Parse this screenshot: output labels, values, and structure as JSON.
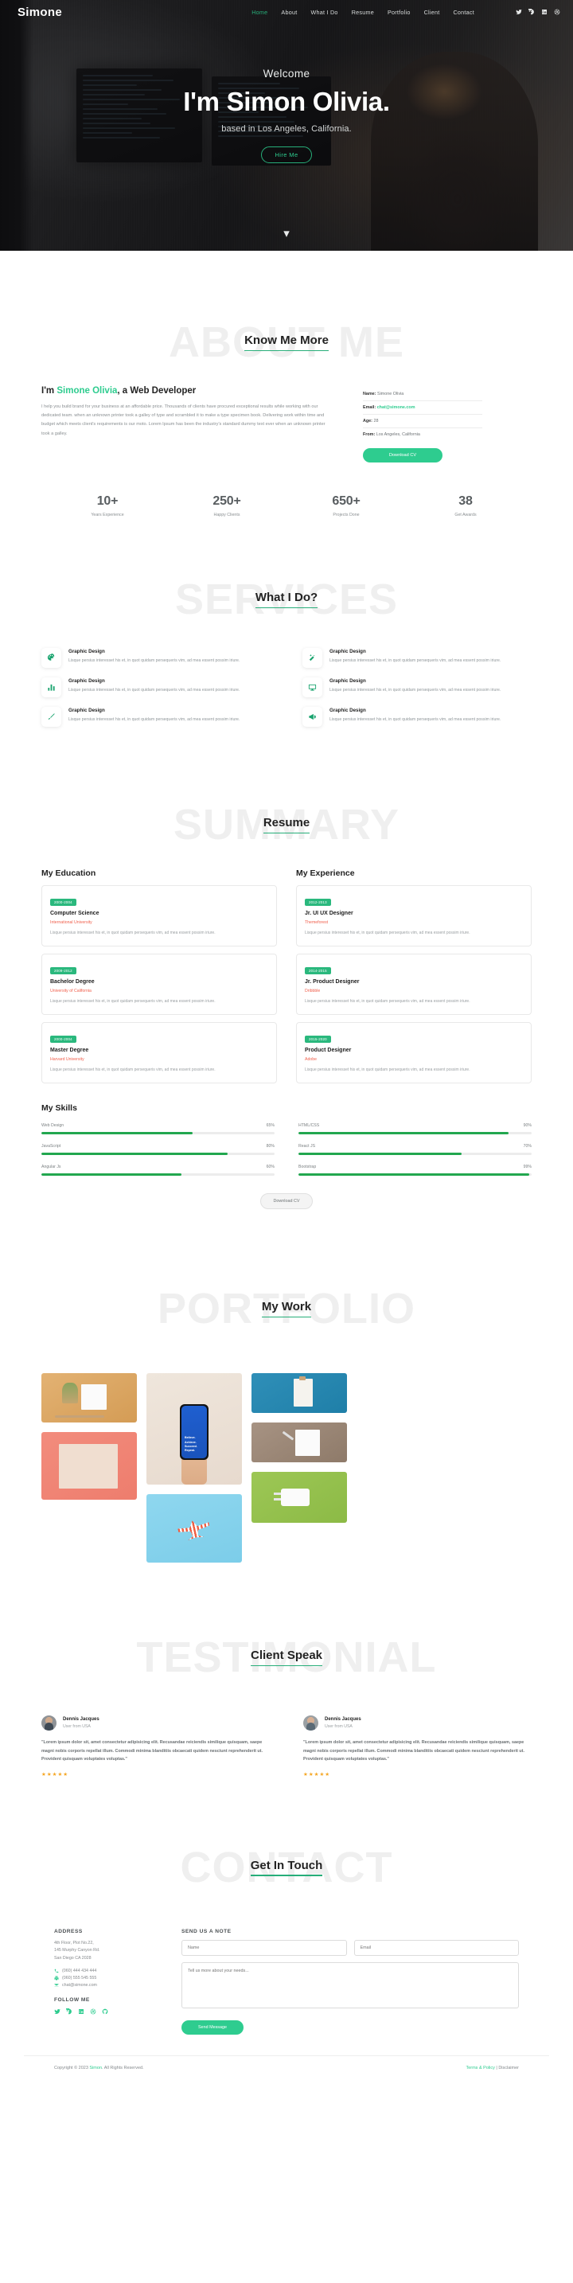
{
  "brand": "Simone",
  "nav": {
    "items": [
      {
        "label": "Home",
        "active": true
      },
      {
        "label": "About",
        "active": false
      },
      {
        "label": "What I Do",
        "active": false
      },
      {
        "label": "Resume",
        "active": false
      },
      {
        "label": "Portfolio",
        "active": false
      },
      {
        "label": "Client",
        "active": false
      },
      {
        "label": "Contact",
        "active": false
      }
    ],
    "social": [
      "twitter-icon",
      "facebook-icon",
      "linkedin-icon",
      "dribbble-icon"
    ]
  },
  "hero": {
    "welcome": "Welcome",
    "title": "I'm Simon Olivia.",
    "subtitle": "based in Los Angeles, California.",
    "cta": "Hire Me",
    "scroll_icon": "chevron-down-icon"
  },
  "about": {
    "ghost": "ABOUT ME",
    "title": "Know Me More",
    "heading_pre": "I'm ",
    "heading_name": "Simone Olivia",
    "heading_post": ", a Web Developer",
    "body": "I help you build brand for your business at an affordable price. Thousands of clients have procured exceptional results while working with our dedicated team. when an unknown printer took a galley of type and scrambled it to make a type specimen book. Delivering work within time and budget which meets client's requirements is our moto. Lorem Ipsum has been the industry's standard dummy text ever when an unknown printer took a galley.",
    "details": [
      {
        "key": "Name:",
        "value": "Simone Olivia",
        "accent": false
      },
      {
        "key": "Email:",
        "value": "chat@simone.com",
        "accent": true
      },
      {
        "key": "Age:",
        "value": "28",
        "accent": false
      },
      {
        "key": "From:",
        "value": "Los Angeles, California",
        "accent": false
      }
    ],
    "download_cv": "Download CV",
    "stats": [
      {
        "num": "10+",
        "label": "Years Experience"
      },
      {
        "num": "250+",
        "label": "Happy Clients"
      },
      {
        "num": "650+",
        "label": "Projects Done"
      },
      {
        "num": "38",
        "label": "Get Awards"
      }
    ]
  },
  "services": {
    "ghost": "SERVICES",
    "title": "What I Do?",
    "desc": "Lisque persius interesset his et, in quot quidam persequeris vim, ad mea essent possim iriure.",
    "items": [
      {
        "icon": "palette-icon",
        "title": "Graphic Design"
      },
      {
        "icon": "magic-wand-icon",
        "title": "Graphic Design"
      },
      {
        "icon": "bar-chart-icon",
        "title": "Graphic Design"
      },
      {
        "icon": "monitor-icon",
        "title": "Graphic Design"
      },
      {
        "icon": "paint-brush-icon",
        "title": "Graphic Design"
      },
      {
        "icon": "megaphone-icon",
        "title": "Graphic Design"
      }
    ]
  },
  "resume": {
    "ghost": "SUMMARY",
    "title": "Resume",
    "education_heading": "My Education",
    "experience_heading": "My Experience",
    "card_desc": "Lisque persius interesset his et, in quot quidam persequeris vim, ad mea essent possim iriure.",
    "education": [
      {
        "years": "2000-2004",
        "title": "Computer Science",
        "org": "International University"
      },
      {
        "years": "2009-2012",
        "title": "Bachelor Degree",
        "org": "University of California"
      },
      {
        "years": "2000-2004",
        "title": "Master Degree",
        "org": "Harvard University"
      }
    ],
    "experience": [
      {
        "years": "2012-2013",
        "title": "Jr. UI UX Designer",
        "org": "Themeforest"
      },
      {
        "years": "2014-2015",
        "title": "Jr. Product Designer",
        "org": "Dribbble"
      },
      {
        "years": "2015-2020",
        "title": "Product Designer",
        "org": "Adobe"
      }
    ],
    "skills_heading": "My Skills",
    "skills": [
      {
        "name": "Web Design",
        "pct": "65%",
        "value": 65
      },
      {
        "name": "HTML/CSS",
        "pct": "90%",
        "value": 90
      },
      {
        "name": "JavaScript",
        "pct": "80%",
        "value": 80
      },
      {
        "name": "React JS",
        "pct": "70%",
        "value": 70
      },
      {
        "name": "Angular Js",
        "pct": "60%",
        "value": 60
      },
      {
        "name": "Bootstrap",
        "pct": "99%",
        "value": 99
      }
    ],
    "download_cv": "Download CV"
  },
  "portfolio": {
    "ghost": "PORTFOLIO",
    "title": "My Work",
    "phone_quote": "Believe.\nAchieve.\nSucceed.\nRepeat.",
    "tiles": [
      {
        "name": "desk-plant-frame",
        "color": "#d9a55f"
      },
      {
        "name": "stacked-papers",
        "color": "#f08271"
      },
      {
        "name": "hand-holding-phone",
        "color": "#ebe0d4"
      },
      {
        "name": "paper-plane",
        "color": "#84d2ec"
      },
      {
        "name": "blue-note-card",
        "color": "#2485b0"
      },
      {
        "name": "brown-desk-paper",
        "color": "#9a8574"
      },
      {
        "name": "green-charger",
        "color": "#95c14d"
      }
    ]
  },
  "testimonial": {
    "ghost": "TESTIMONIAL",
    "title": "Client Speak",
    "items": [
      {
        "name": "Dennis Jacques",
        "role": "User from USA",
        "quote": "\"Lorem ipsum dolor sit, amet consectetur adipisicing elit. Recusandae reiciendis similique quisquam, saepe magni nobis corporis repellat illum. Commodi minima blanditiis obcaecati quidem nesciunt reprehenderit ut. Provident quisquam voluptates voluptas.\"",
        "stars": 5
      },
      {
        "name": "Dennis Jacques",
        "role": "User from USA",
        "quote": "\"Lorem ipsum dolor sit, amet consectetur adipisicing elit. Recusandae reiciendis similique quisquam, saepe magni nobis corporis repellat illum. Commodi minima blanditiis obcaecati quidem nesciunt reprehenderit ut. Provident quisquam voluptates voluptas.\"",
        "stars": 5
      }
    ]
  },
  "contact": {
    "ghost": "CONTACT",
    "title": "Get In Touch",
    "address_heading": "ADDRESS",
    "address_lines": "4th Floor, Plot No.22,\n145 Murphy Canyon Rd.\nSan Diego CA 2028",
    "phone": "(060) 444 434 444",
    "fax": "(060) 555 545 555",
    "email": "chat@simone.com",
    "follow_heading": "FOLLOW ME",
    "follow_icons": [
      "twitter-icon",
      "facebook-icon",
      "linkedin-icon",
      "dribbble-icon",
      "github-icon"
    ],
    "form_heading": "SEND US A NOTE",
    "name_placeholder": "Name",
    "email_placeholder": "Email",
    "message_placeholder": "Tell us more about your needs...",
    "send_label": "Send Message"
  },
  "footer": {
    "copy_pre": "Copyright © 2023 ",
    "copy_brand": "Simon",
    "copy_post": ". All Rights Reserved.",
    "terms": "Terms & Policy",
    "sep": " | ",
    "disclaimer": "Disclaimer"
  },
  "colors": {
    "accent": "#2ecc8f",
    "accent_dark": "#1aa46f",
    "badge": "#2ab87d",
    "org": "#f0604d",
    "bar": "#22a74f",
    "star": "#f5a623",
    "ghost": "#efefef"
  }
}
